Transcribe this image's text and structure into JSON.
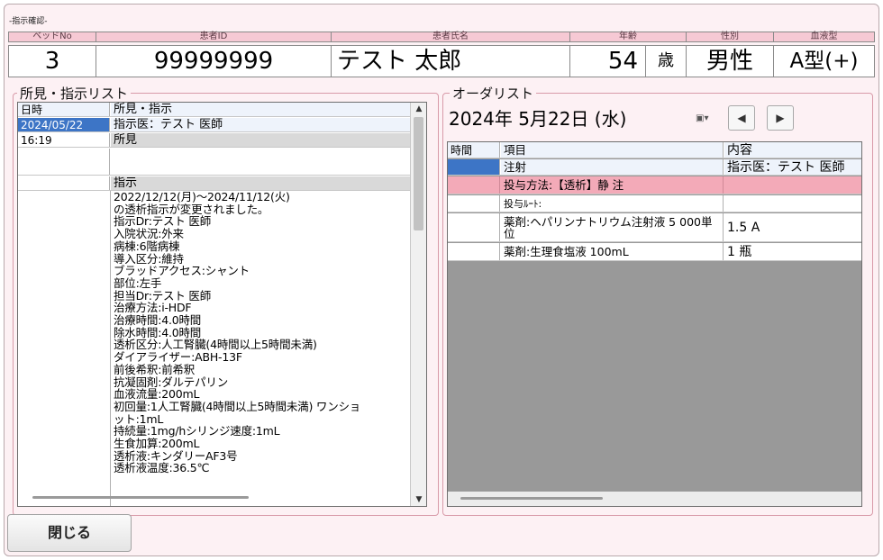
{
  "window": {
    "title": "-指示確認-"
  },
  "header": {
    "labels": {
      "bed": "ベッドNo",
      "patient_id": "患者ID",
      "patient_name": "患者氏名",
      "age": "年齢",
      "sex": "性別",
      "blood": "血液型"
    },
    "values": {
      "bed": "3",
      "patient_id": "99999999",
      "patient_name": "テスト 太郎",
      "age": "54",
      "age_unit": "歳",
      "sex": "男性",
      "blood": "A型(+)"
    }
  },
  "findings": {
    "title": "所見・指示リスト",
    "col_date": "日時",
    "col_content": "所見・指示",
    "rows": [
      {
        "date": "2024/05/22",
        "text": "指示医：テスト 医師"
      },
      {
        "date": "16:19",
        "text": "所見"
      },
      {
        "date": "",
        "text": ""
      },
      {
        "date": "",
        "text": "指示"
      }
    ],
    "instruction_lines": [
      "2022/12/12(月)～2024/11/12(火)",
      "の透析指示が変更されました。",
      "指示Dr:テスト 医師",
      "入院状況:外来",
      "病棟:6階病棟",
      "導入区分:維持",
      "ブラッドアクセス:シャント",
      "部位:左手",
      "担当Dr:テスト 医師",
      "治療方法:i-HDF",
      "治療時間:4.0時間",
      "除水時間:4.0時間",
      "透析区分:人工腎臓(4時間以上5時間未満)",
      "ダイアライザー:ABH-13F",
      "前後希釈:前希釈",
      "抗凝固剤:ダルテパリン",
      "血液流量:200mL",
      "初回量:1人工腎臓(4時間以上5時間未満) ワンショ",
      "ット:1mL",
      "持続量:1mg/hシリンジ速度:1mL",
      "生食加算:200mL",
      "透析液:キンダリーAF3号",
      "透析液温度:36.5℃"
    ]
  },
  "orders": {
    "title": "オーダリスト",
    "date": "2024年 5月22日 (水)",
    "prev_label": "◀",
    "next_label": "▶",
    "dropdown_symbol": "▣▾",
    "columns": {
      "time": "時間",
      "item": "項目",
      "content": "内容"
    },
    "rows": [
      {
        "time": "",
        "item": "注射",
        "content": "指示医：テスト 医師"
      },
      {
        "time": "",
        "item": "投与方法:【透析】静 注",
        "content": ""
      },
      {
        "time": "",
        "item": "投与ﾙｰﾄ:",
        "content": ""
      },
      {
        "time": "",
        "item": "薬剤:ヘパリンナトリウム注射液 5 000単位",
        "content": "1.5 A"
      },
      {
        "time": "",
        "item": "薬剤:生理食塩液 100mL",
        "content": "1 瓶"
      }
    ]
  },
  "close_label": "閉じる",
  "colors": {
    "background": "#fdf1f4",
    "label": "#f6c9d4",
    "select": "#3d75c6",
    "pink_row": "#f3aab8"
  }
}
